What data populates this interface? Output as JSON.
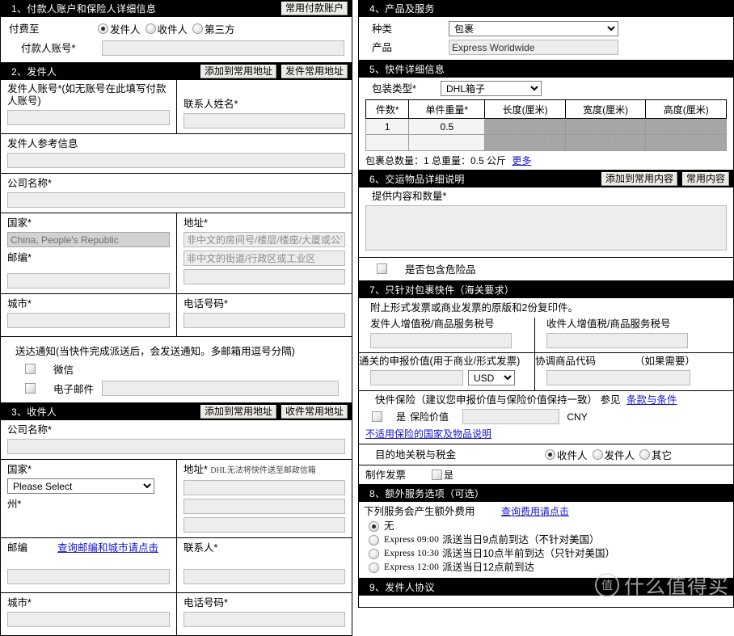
{
  "sections": {
    "s1": {
      "title": "1、付款人账户和保险人详细信息",
      "button": "常用付款账户",
      "payto_label": "付费至",
      "payto_options": [
        "发件人",
        "收件人",
        "第三方"
      ],
      "payto_selected": "发件人",
      "payer_account_label": "付款人账号*",
      "payer_account_value": ""
    },
    "s2": {
      "title": "2、发件人",
      "btn_add": "添加到常用地址",
      "btn_book": "发件常用地址",
      "shipper_acct_label": "发件人账号*(如无账号在此填写付款人账号)",
      "shipper_acct_value": "",
      "contact_label": "联系人姓名*",
      "contact_value": "",
      "reference_label": "发件人参考信息",
      "reference_value": "",
      "company_label": "公司名称*",
      "company_value": "",
      "country_label": "国家*",
      "country_value": "China, People's Republic",
      "postcode_label": "邮编*",
      "postcode_value": "",
      "address_label": "地址*",
      "address1_placeholder": "非中文的房间号/楼层/楼座/大厦或公司名称",
      "address2_placeholder": "非中文的街道/行政区或工业区",
      "address3_value": "",
      "city_label": "城市*",
      "city_value": "",
      "phone_label": "电话号码*",
      "phone_value": "",
      "notify_label": "送达通知(当快件完成派送后，会发送通知。多邮箱用逗号分隔)",
      "notify_wechat": "微信",
      "notify_email": "电子邮件",
      "notify_email_value": ""
    },
    "s3": {
      "title": "3、收件人",
      "btn_add": "添加到常用地址",
      "btn_book": "收件常用地址",
      "company_label": "公司名称*",
      "company_value": "",
      "country_label": "国家*",
      "country_value": "Please Select",
      "state_label": "州*",
      "address_label": "地址*",
      "address_note": "DHL无法将快件送至邮政信箱",
      "address1_value": "",
      "address2_value": "",
      "address3_value": "",
      "postcode_label": "邮编",
      "postcode_link": "查询邮编和城市请点击",
      "postcode_value": "",
      "contact_label": "联系人*",
      "contact_value": "",
      "city_label": "城市*",
      "phone_label": "电话号码*"
    },
    "s4": {
      "title": "4、产品及服务",
      "type_label": "种类",
      "type_value": "包裹",
      "product_label": "产品",
      "product_value": "Express Worldwide"
    },
    "s5": {
      "title": "5、快件详细信息",
      "pkgtype_label": "包装类型*",
      "pkgtype_value": "DHL箱子",
      "columns": [
        "件数*",
        "单件重量*",
        "长度(厘米)",
        "宽度(厘米)",
        "高度(厘米)"
      ],
      "rows": [
        [
          "1",
          "0.5",
          "",
          "",
          ""
        ],
        [
          "",
          "",
          "",
          "",
          ""
        ]
      ],
      "total_text": "包裹总数量：1  总重量：0.5 公斤",
      "total_link": "更多"
    },
    "s6": {
      "title": "6、交运物品详细说明",
      "btn_add": "添加到常用内容",
      "btn_book": "常用内容",
      "content_label": "提供内容和数量*",
      "content_value": "",
      "dangerous_label": "是否包含危险品"
    },
    "s7": {
      "title": "7、只针对包裹快件（海关要求）",
      "invoice_note": "附上形式发票或商业发票的原版和2份复印件。",
      "shipper_vat_label": "发件人增值税/商品服务税号",
      "shipper_vat_value": "",
      "receiver_vat_label": "收件人增值税/商品服务税号",
      "receiver_vat_value": "",
      "declared_label": "通关的申报价值(用于商业/形式发票)",
      "declared_value": "",
      "declared_currency": "USD",
      "hs_label": "协调商品代码",
      "hs_label_note": "（如果需要）",
      "hs_value": "",
      "insurance_label": "快件保险（建议您申报价值与保险价值保持一致）  参见",
      "insurance_terms_link": "条款与条件",
      "insurance_yes": "是",
      "insurance_value_label": "保险价值",
      "insurance_value": "",
      "insurance_currency": "CNY",
      "insurance_exclusion_link": "不适用保险的国家及物品说明",
      "duties_label": "目的地关税与税金",
      "duties_options": [
        "收件人",
        "发件人",
        "其它"
      ],
      "duties_selected": "收件人",
      "make_invoice_label": "制作发票",
      "make_invoice_yes": "是"
    },
    "s8": {
      "title": "8、额外服务选项（可选）",
      "note": "下列服务会产生额外费用",
      "fee_link": "查询费用请点击",
      "options": [
        {
          "code": "",
          "label": "无",
          "selected": true
        },
        {
          "code": "Express 09:00",
          "label": "派送当日9点前到达（不针对美国）",
          "selected": false
        },
        {
          "code": "Express 10:30",
          "label": "派送当日10点半前到达（只针对美国）",
          "selected": false
        },
        {
          "code": "Express 12:00",
          "label": "派送当日12点前到达",
          "selected": false
        }
      ]
    },
    "s9": {
      "title": "9、发件人协议"
    }
  },
  "watermark": {
    "mark": "值",
    "text": "什么值得",
    "text_fade": "买"
  }
}
